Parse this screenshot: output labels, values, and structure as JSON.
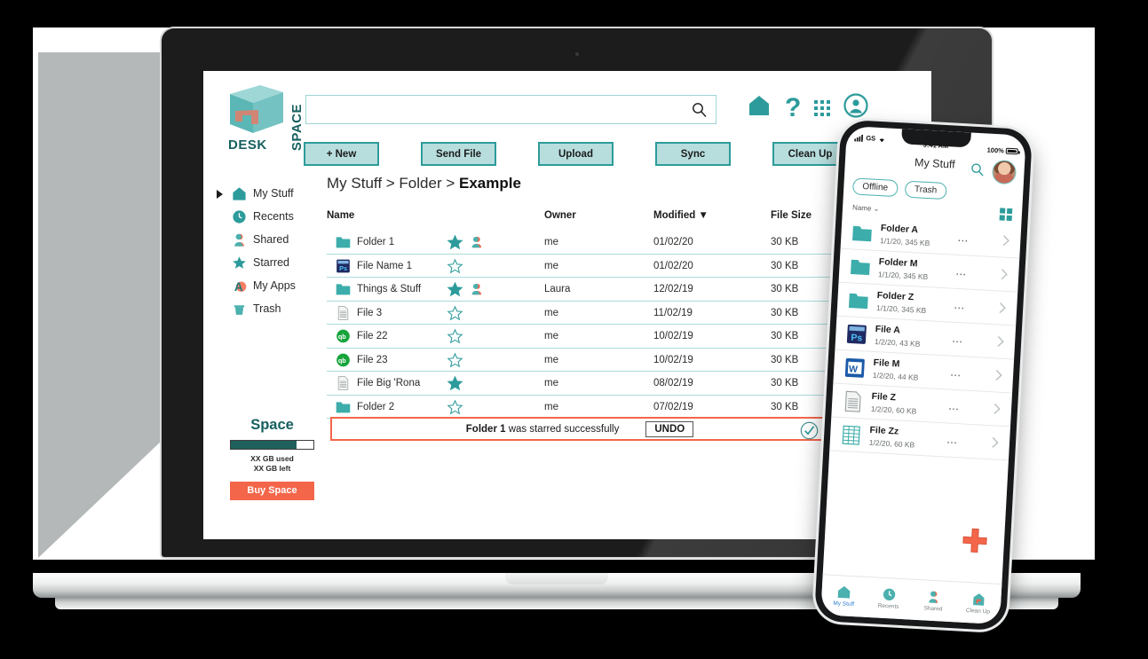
{
  "brand": {
    "logo_desk": "DESK",
    "logo_space": "SPACE",
    "teal": "#2d9b9b",
    "teal_dark": "#16605f",
    "teal_light": "#b7dedd",
    "salmon": "#f4664a",
    "row_divider": "#a9dbdb"
  },
  "desktop": {
    "search": {
      "value": "",
      "placeholder": "",
      "icon": "search-icon"
    },
    "header_icons": [
      {
        "name": "home-icon",
        "label": "Home"
      },
      {
        "name": "help-icon",
        "label": "?"
      },
      {
        "name": "apps-grid-icon",
        "label": "Apps"
      },
      {
        "name": "account-avatar-icon",
        "label": "Account"
      }
    ],
    "toolbar": [
      {
        "label": "+ New",
        "name": "new-button"
      },
      {
        "label": "Send File",
        "name": "send-file-button"
      },
      {
        "label": "Upload",
        "name": "upload-button"
      },
      {
        "label": "Sync",
        "name": "sync-button"
      },
      {
        "label": "Clean Up",
        "name": "clean-up-button"
      }
    ],
    "sidebar": {
      "items": [
        {
          "label": "My Stuff",
          "icon": "home-icon",
          "expandable": true
        },
        {
          "label": "Recents",
          "icon": "clock-icon",
          "expandable": false
        },
        {
          "label": "Shared",
          "icon": "person-icon",
          "expandable": false
        },
        {
          "label": "Starred",
          "icon": "star-icon",
          "expandable": false
        },
        {
          "label": "My Apps",
          "icon": "apps-a-icon",
          "expandable": false
        },
        {
          "label": "Trash",
          "icon": "trash-icon",
          "expandable": false
        }
      ],
      "space": {
        "title": "Space",
        "used_percent": 80,
        "used_text": "XX GB used",
        "left_text": "XX GB left",
        "buy_label": "Buy Space"
      }
    },
    "breadcrumb": {
      "part1": "My Stuff",
      "sep1": " > ",
      "part2": "Folder",
      "sep2": " > ",
      "current": "Example"
    },
    "table": {
      "columns": [
        "Name",
        "Owner",
        "Modified",
        "File Size"
      ],
      "sorted_by": "Modified",
      "sort_indicator": "▼",
      "rows": [
        {
          "name": "Folder 1",
          "icon": "folder-icon",
          "starred": true,
          "shared": true,
          "owner": "me",
          "modified": "01/02/20",
          "size": "30 KB"
        },
        {
          "name": "File Name 1",
          "icon": "photoshop-icon",
          "starred": false,
          "shared": false,
          "owner": "me",
          "modified": "01/02/20",
          "size": "30 KB"
        },
        {
          "name": "Things & Stuff",
          "icon": "folder-icon",
          "starred": true,
          "shared": true,
          "owner": "Laura",
          "modified": "12/02/19",
          "size": "30 KB"
        },
        {
          "name": "File 3",
          "icon": "document-icon",
          "starred": false,
          "shared": false,
          "owner": "me",
          "modified": "11/02/19",
          "size": "30 KB"
        },
        {
          "name": "File 22",
          "icon": "quickbooks-icon",
          "starred": false,
          "shared": false,
          "owner": "me",
          "modified": "10/02/19",
          "size": "30 KB"
        },
        {
          "name": "File 23",
          "icon": "quickbooks-icon",
          "starred": false,
          "shared": false,
          "owner": "me",
          "modified": "10/02/19",
          "size": "30 KB"
        },
        {
          "name": "File Big 'Rona",
          "icon": "document-icon",
          "starred": true,
          "shared": false,
          "owner": "me",
          "modified": "08/02/19",
          "size": "30 KB"
        },
        {
          "name": "Folder 2",
          "icon": "folder-icon",
          "starred": false,
          "shared": false,
          "owner": "me",
          "modified": "07/02/19",
          "size": "30 KB"
        }
      ]
    },
    "toast": {
      "subject": "Folder 1",
      "message": " was starred successfully",
      "undo_label": "UNDO",
      "check_icon": "check-circle-icon"
    }
  },
  "mobile": {
    "status": {
      "carrier": "GS",
      "time": "9:41 AM",
      "battery": "100%"
    },
    "title": "My Stuff",
    "pills": [
      {
        "label": "Offline",
        "name": "offline-pill"
      },
      {
        "label": "Trash",
        "name": "trash-pill"
      }
    ],
    "sort_label": "Name",
    "sort_caret": "⌄",
    "list": [
      {
        "name": "Folder A",
        "icon": "folder-icon",
        "meta": "1/1/20, 345 KB"
      },
      {
        "name": "Folder M",
        "icon": "folder-icon",
        "meta": "1/1/20, 345 KB"
      },
      {
        "name": "Folder Z",
        "icon": "folder-icon",
        "meta": "1/1/20, 345 KB"
      },
      {
        "name": "File A",
        "icon": "photoshop-icon",
        "meta": "1/2/20, 43 KB"
      },
      {
        "name": "File M",
        "icon": "word-icon",
        "meta": "1/2/20, 44 KB"
      },
      {
        "name": "File Z",
        "icon": "document-icon",
        "meta": "1/2/20, 60 KB"
      },
      {
        "name": "File Zz",
        "icon": "spreadsheet-icon",
        "meta": "1/2/20, 60 KB"
      }
    ],
    "fab": {
      "name": "add-fab",
      "icon": "plus-icon"
    },
    "tabs": [
      {
        "label": "My Stuff",
        "icon": "home-icon",
        "active": true
      },
      {
        "label": "Recents",
        "icon": "clock-icon",
        "active": false
      },
      {
        "label": "Shared",
        "icon": "person-icon",
        "active": false
      },
      {
        "label": "Clean Up",
        "icon": "cleanup-icon",
        "active": false
      }
    ]
  }
}
